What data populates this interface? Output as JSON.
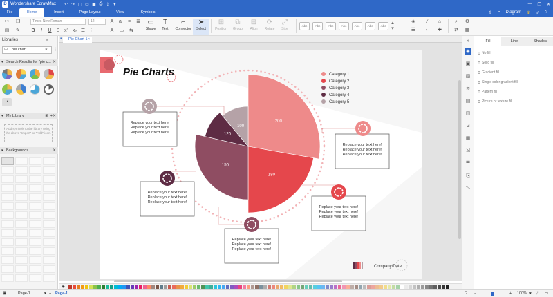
{
  "window": {
    "title": "Wondershare EdrawMax",
    "user": "Diagram"
  },
  "menu": {
    "tabs": [
      "File",
      "Home",
      "Insert",
      "Page Layout",
      "View",
      "Symbols"
    ],
    "active": "Home"
  },
  "ribbon": {
    "font_name": "Times New Roman",
    "font_size": "12",
    "tools": [
      "Shape",
      "Text",
      "Connector",
      "Select",
      "Position",
      "Group",
      "Align",
      "Rotate",
      "Size"
    ],
    "style_label": "Abc"
  },
  "left_panel": {
    "title": "Libraries",
    "search_value": "pie chart",
    "results_header": "Search Results for \"pie c...",
    "library_header": "My Library",
    "library_hint": "Add symbols to the library using the above \"Import\" or \"Add\" icon.",
    "backgrounds_header": "Backgrounds"
  },
  "document": {
    "tab": "Pie Chart 1"
  },
  "chart_data": {
    "type": "pie",
    "title": "Pie Charts",
    "categories": [
      "Category 1",
      "Category 2",
      "Category 3",
      "Category 4",
      "Category 5"
    ],
    "values": [
      200,
      180,
      150,
      120,
      100
    ],
    "colors": [
      "#ee8a8a",
      "#e5474c",
      "#8f4d62",
      "#5e2c44",
      "#b5a2a7"
    ],
    "legend_position": "top-right",
    "callout_text": "Replace your text here!",
    "footer": "Company/Date"
  },
  "right_panel": {
    "tabs": [
      "Fill",
      "Line",
      "Shadow"
    ],
    "active_tab": "Fill",
    "fill_options": [
      "No fill",
      "Solid fill",
      "Gradient fill",
      "Single color gradient fill",
      "Pattern fill",
      "Picture or texture fill"
    ]
  },
  "status": {
    "page_tab": "Page-1",
    "page_active": "Page-1",
    "zoom": "100%"
  }
}
